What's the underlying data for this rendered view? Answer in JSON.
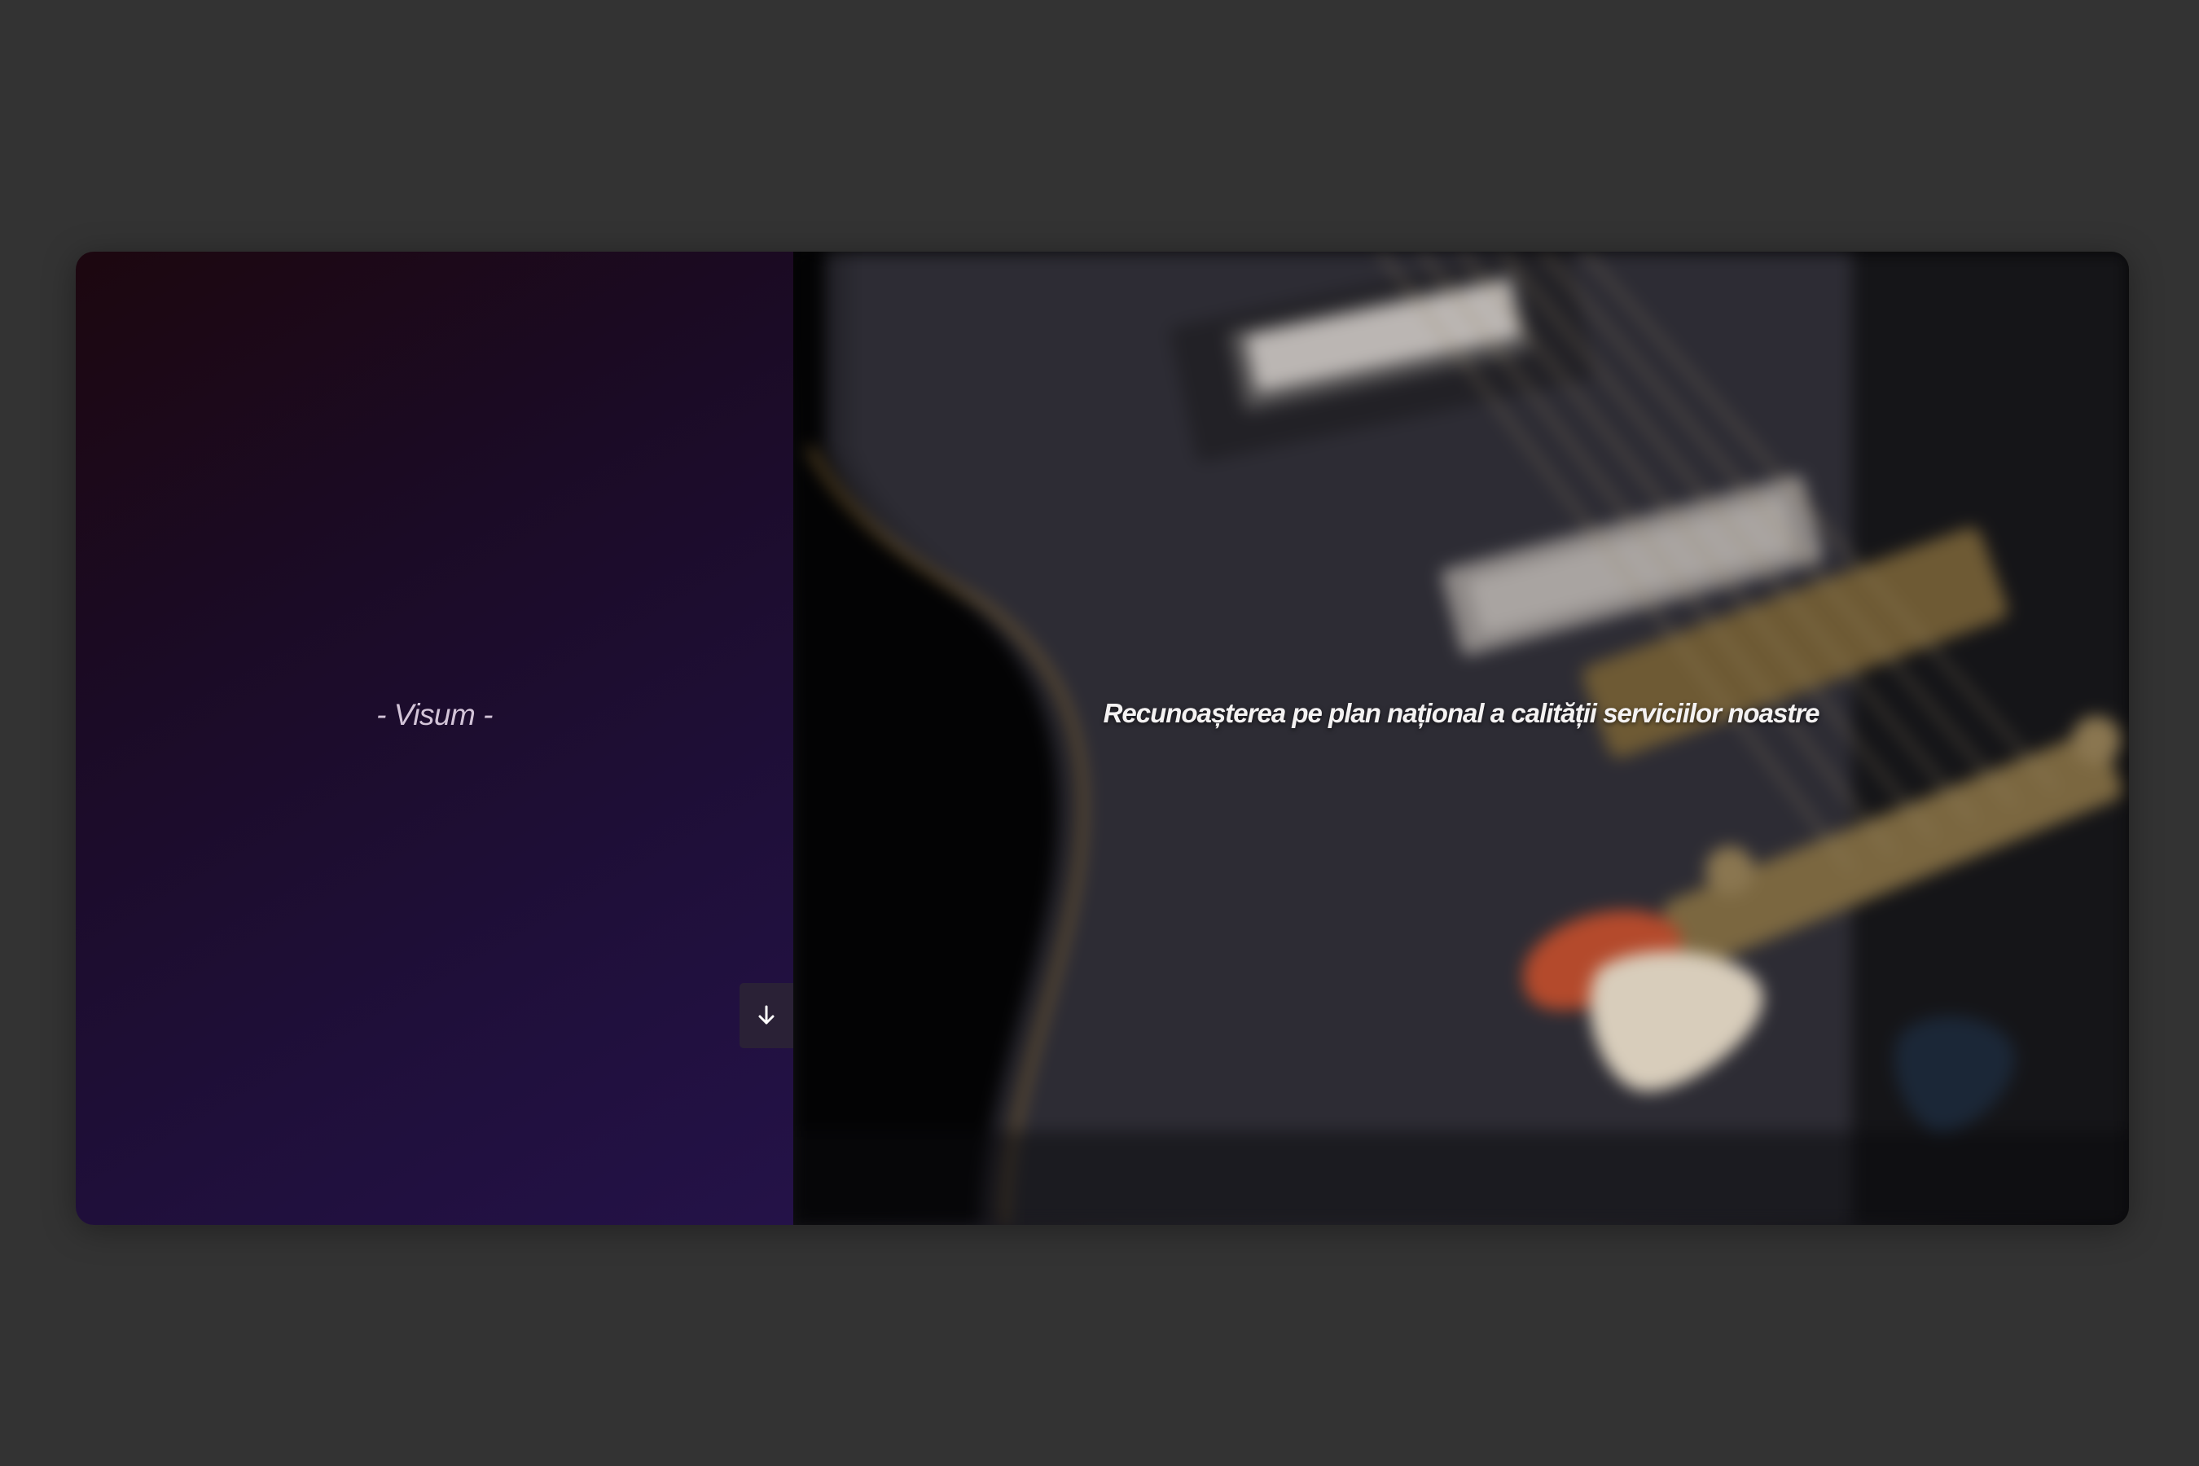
{
  "page": {
    "background_color": "#333333"
  },
  "hero": {
    "brand_text": "- Visum -",
    "tagline": "Recunoașterea pe plan național a calității serviciilor noastre",
    "scroll_down_icon": "arrow-down-icon",
    "left_gradient_colors": [
      "#1c070f",
      "#1b0b26",
      "#1f0f3a",
      "#241248"
    ],
    "background_image_subject": "blurred black electric guitar with gold hardware and guitar picks"
  }
}
